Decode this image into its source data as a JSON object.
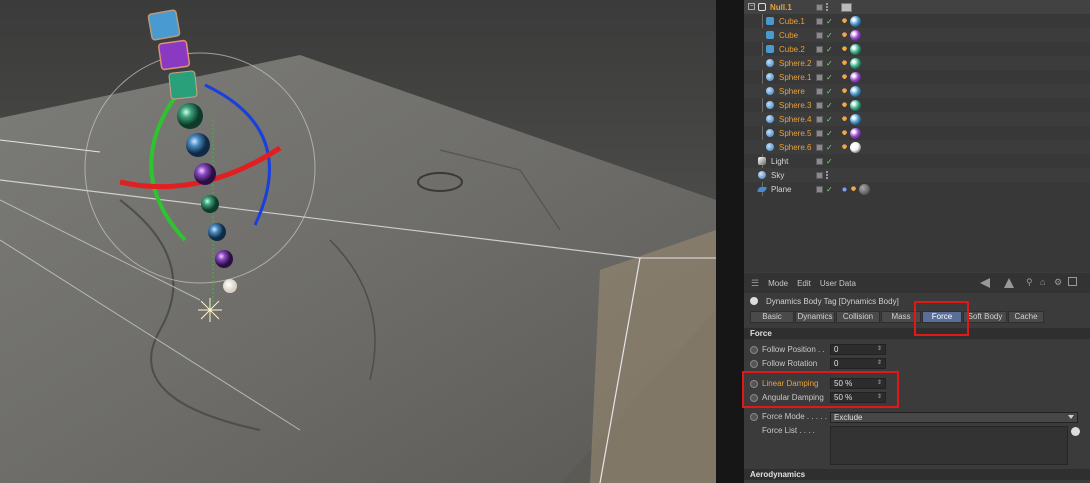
{
  "object_manager": {
    "null_name": "Null.1",
    "children": [
      {
        "name": "Cube.1",
        "type": "cube",
        "mat": "#4a9ad2"
      },
      {
        "name": "Cube",
        "type": "cube",
        "mat": "#9a4ad2"
      },
      {
        "name": "Cube.2",
        "type": "cube",
        "mat": "#3ab08a"
      },
      {
        "name": "Sphere.2",
        "type": "sphere",
        "mat": "#3ab08a"
      },
      {
        "name": "Sphere.1",
        "type": "sphere",
        "mat": "#9a4ad2"
      },
      {
        "name": "Sphere",
        "type": "sphere",
        "mat": "#4a9ad2"
      },
      {
        "name": "Sphere.3",
        "type": "sphere",
        "mat": "#3ab08a"
      },
      {
        "name": "Sphere.4",
        "type": "sphere",
        "mat": "#4a9ad2"
      },
      {
        "name": "Sphere.5",
        "type": "sphere",
        "mat": "#9a4ad2"
      },
      {
        "name": "Sphere.6",
        "type": "sphere",
        "mat": "#f5f5f5"
      }
    ],
    "others": [
      {
        "name": "Light",
        "type": "light"
      },
      {
        "name": "Sky",
        "type": "sky"
      },
      {
        "name": "Plane",
        "type": "plane"
      }
    ]
  },
  "attribute_manager": {
    "menu": [
      "Mode",
      "Edit",
      "User Data"
    ],
    "title": "Dynamics Body Tag [Dynamics Body]",
    "tabs": [
      "Basic",
      "Dynamics",
      "Collision",
      "Mass",
      "Force",
      "Soft Body",
      "Cache"
    ],
    "active_tab": "Force",
    "force_section": "Force",
    "fields": [
      {
        "label": "Follow Position . .",
        "value": "0",
        "highlight": false
      },
      {
        "label": "Follow Rotation",
        "value": "0",
        "highlight": false
      },
      {
        "label": "Linear Damping",
        "value": "50 %",
        "highlight": true
      },
      {
        "label": "Angular Damping",
        "value": "50 %",
        "highlight": false
      }
    ],
    "force_mode_label": "Force Mode . . . . .",
    "force_mode_value": "Exclude",
    "force_list_label": "Force List . . . .",
    "aero_section": "Aerodynamics"
  },
  "colors": {
    "highlight_box": "#e01818",
    "active_tab": "#5a6e9a",
    "object_name": "#e8a13a"
  }
}
